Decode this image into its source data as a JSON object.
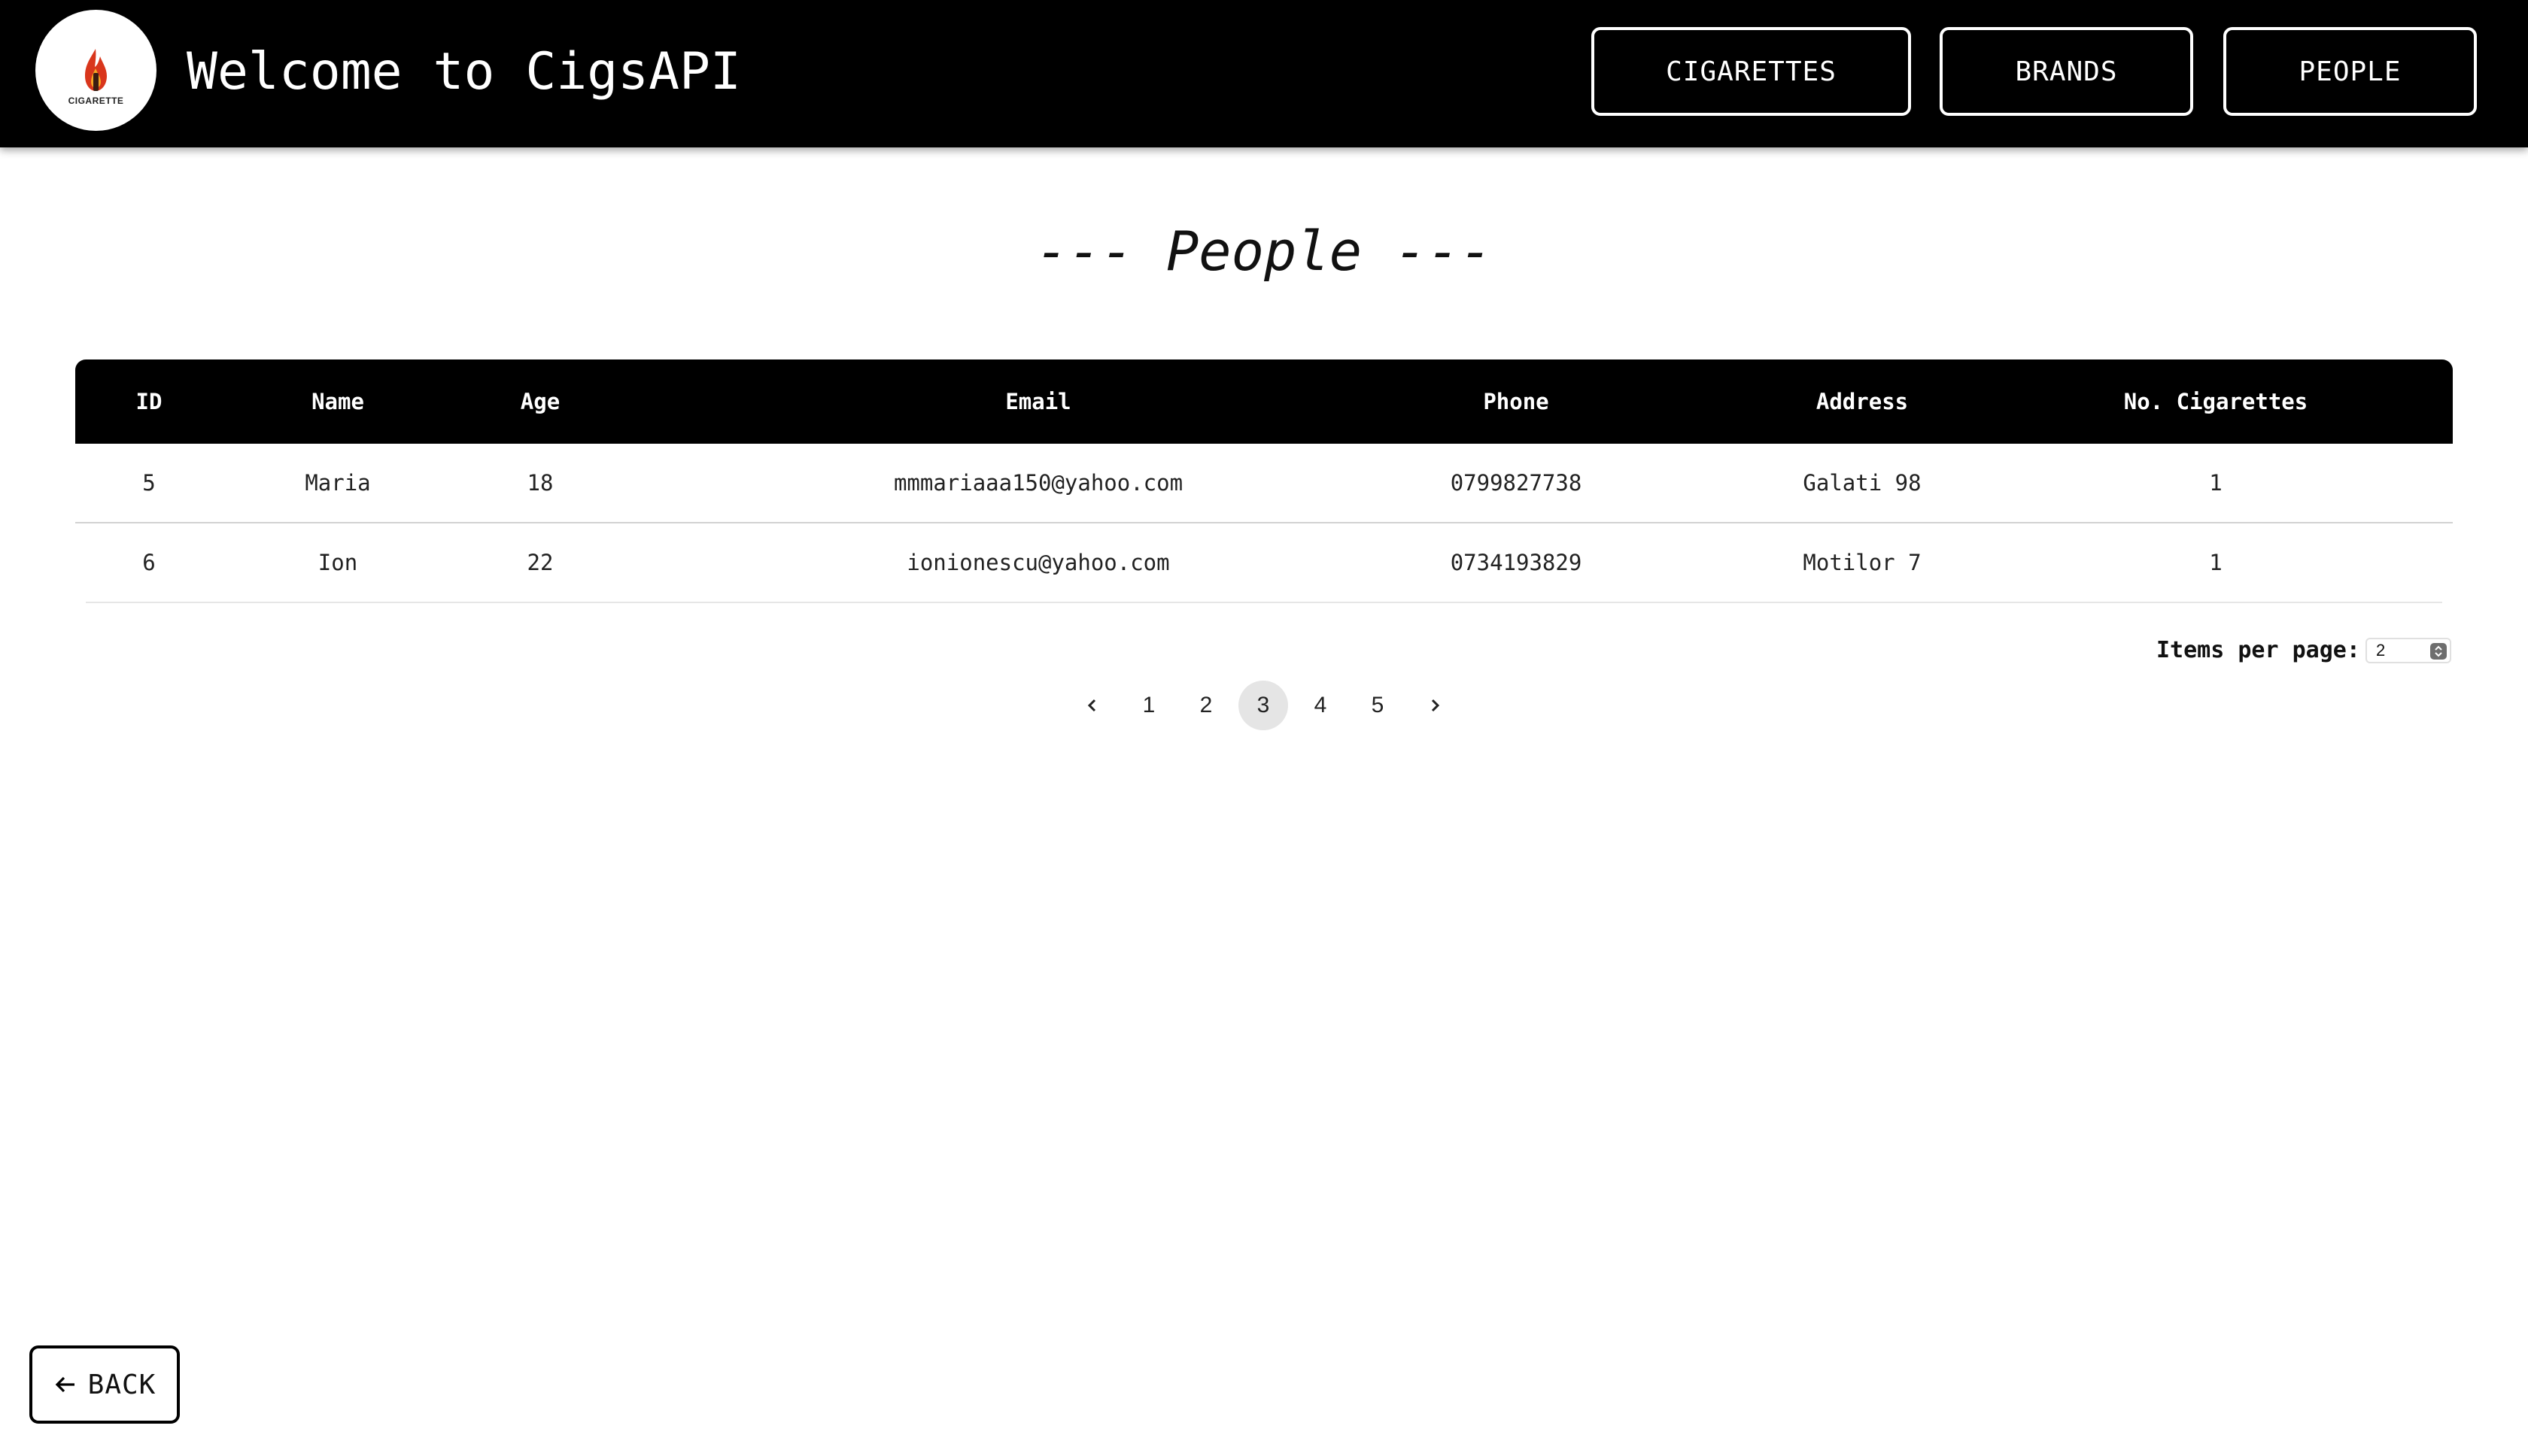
{
  "header": {
    "logo_caption": "CIGARETTE",
    "title": "Welcome to CigsAPI",
    "nav": {
      "cigarettes": "CIGARETTES",
      "brands": "BRANDS",
      "people": "PEOPLE"
    },
    "logo_icon": "flame-cigarette-logo"
  },
  "page": {
    "title": "--- People ---"
  },
  "table": {
    "columns": {
      "id": "ID",
      "name": "Name",
      "age": "Age",
      "email": "Email",
      "phone": "Phone",
      "address": "Address",
      "cigs": "No. Cigarettes"
    },
    "rows": [
      {
        "id": "5",
        "name": "Maria",
        "age": "18",
        "email": "mmmariaaa150@yahoo.com",
        "phone": "0799827738",
        "address": "Galati 98",
        "cigs": "1"
      },
      {
        "id": "6",
        "name": "Ion",
        "age": "22",
        "email": "ionionescu@yahoo.com",
        "phone": "0734193829",
        "address": "Motilor 7",
        "cigs": "1"
      }
    ]
  },
  "paginator": {
    "items_per_page_label": "Items per page:",
    "items_per_page_value": "2",
    "pages": [
      "1",
      "2",
      "3",
      "4",
      "5"
    ],
    "current_page": "3"
  },
  "back": {
    "label": "BACK"
  },
  "colors": {
    "header_bg": "#000000",
    "active_page_bg": "#e5e5e5",
    "logo_flame": "#d9361c"
  }
}
